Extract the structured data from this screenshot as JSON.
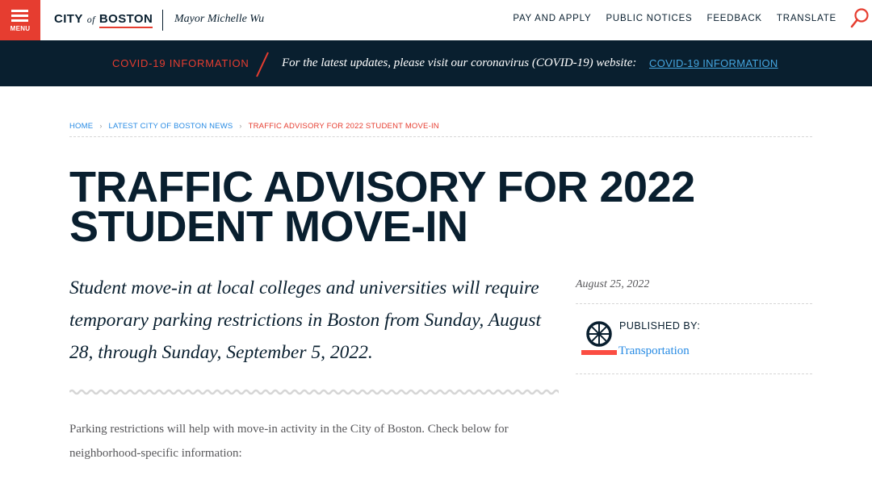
{
  "header": {
    "menu_label": "MENU",
    "logo": {
      "city": "CITY",
      "of": "of",
      "boston": "BOSTON"
    },
    "mayor": "Mayor Michelle Wu",
    "nav": [
      "PAY AND APPLY",
      "PUBLIC NOTICES",
      "FEEDBACK",
      "TRANSLATE"
    ],
    "search_icon": "search-icon"
  },
  "alert": {
    "title": "COVID-19 INFORMATION",
    "text": "For the latest updates, please visit our coronavirus (COVID-19) website:",
    "link": "COVID-19 INFORMATION"
  },
  "breadcrumb": {
    "home": "HOME",
    "news": "LATEST CITY OF BOSTON NEWS",
    "current": "TRAFFIC ADVISORY FOR 2022 STUDENT MOVE-IN",
    "separator": "›"
  },
  "article": {
    "title": "TRAFFIC ADVISORY FOR 2022 STUDENT MOVE-IN",
    "intro": "Student move-in at local colleges and universities will require temporary parking restrictions in Boston from Sunday, August 28, through Sunday, September 5, 2022.",
    "body": "Parking restrictions will help with move-in activity in the City of Boston. Check below for neighborhood-specific information:"
  },
  "sidebar": {
    "date": "August 25, 2022",
    "published_label": "PUBLISHED BY:",
    "department": "Transportation",
    "department_icon": "wheel-icon"
  },
  "colors": {
    "brand_red": "#e63d30",
    "navy": "#091f2f",
    "link_blue": "#288be4",
    "alert_link": "#45a6e0"
  }
}
